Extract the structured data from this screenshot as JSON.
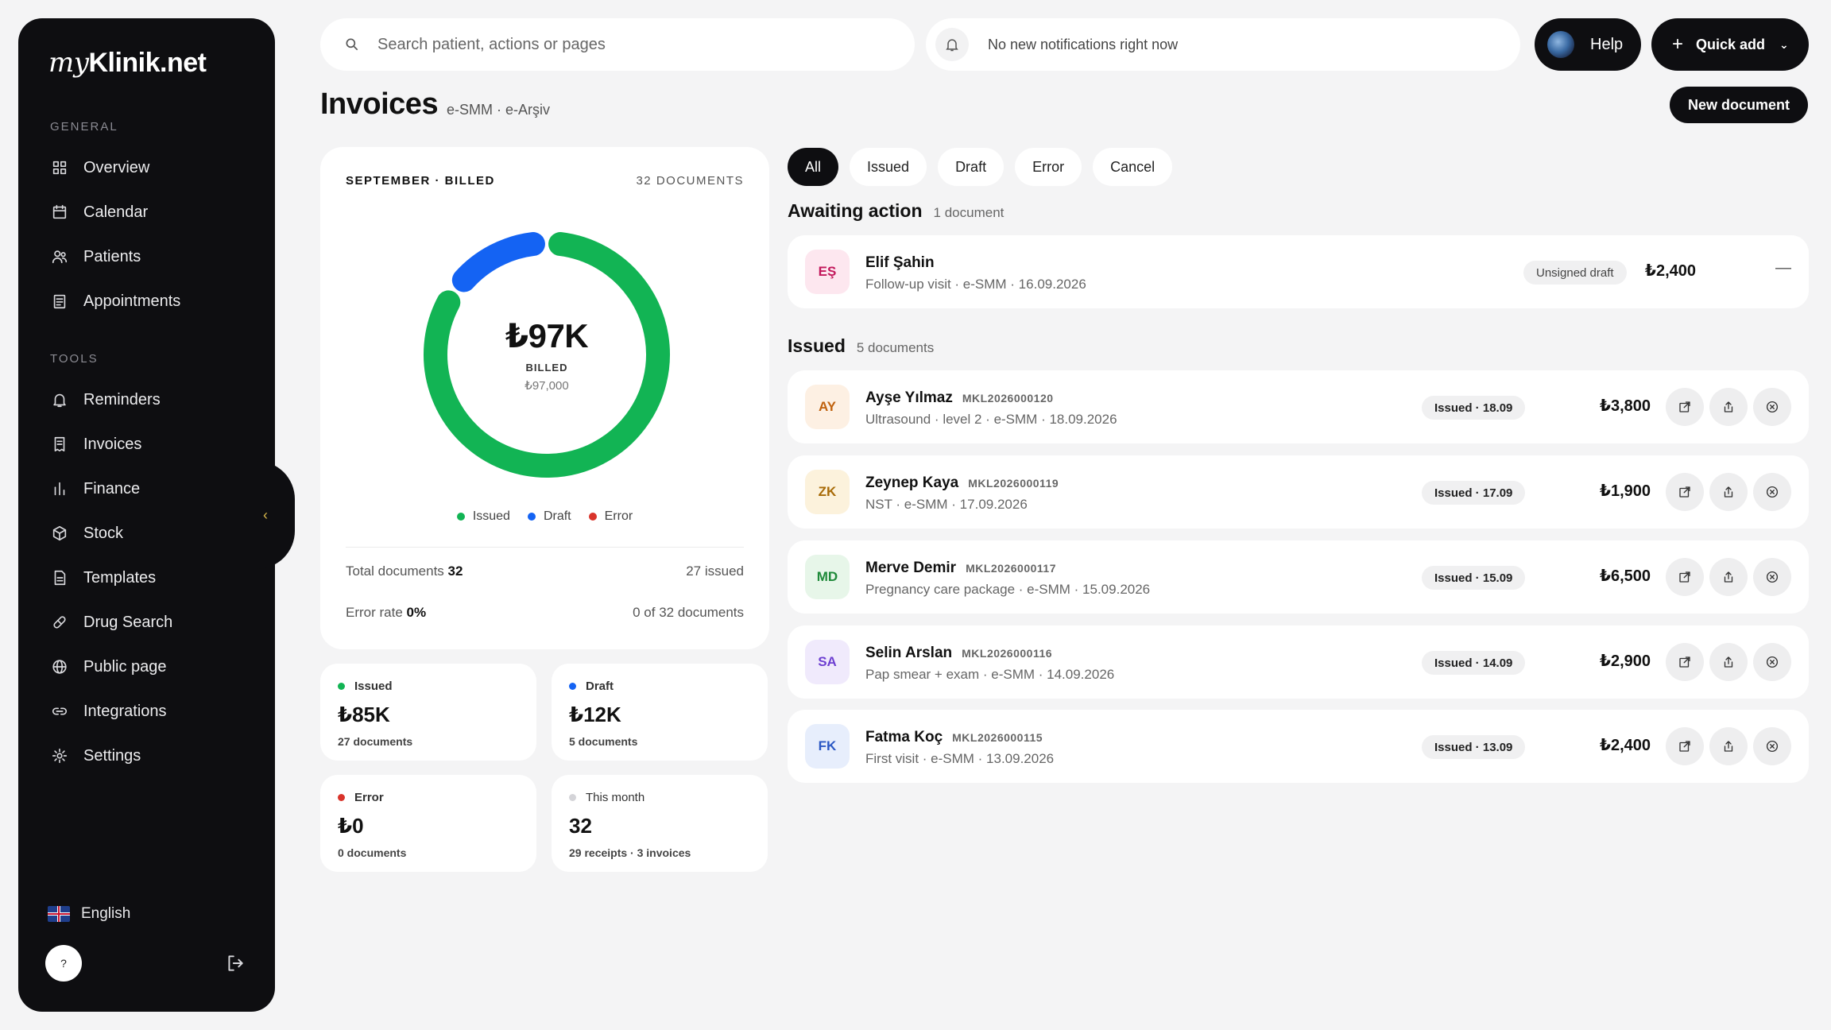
{
  "sidebar": {
    "logo_prefix": "my",
    "logo_rest": "Klinik.net",
    "general_label": "GENERAL",
    "tools_label": "TOOLS",
    "general_items": [
      {
        "label": "Overview",
        "icon": "grid-icon"
      },
      {
        "label": "Calendar",
        "icon": "calendar-icon"
      },
      {
        "label": "Patients",
        "icon": "users-icon"
      },
      {
        "label": "Appointments",
        "icon": "clipboard-icon"
      }
    ],
    "tools_items": [
      {
        "label": "Reminders",
        "icon": "bell-icon"
      },
      {
        "label": "Invoices",
        "icon": "receipt-icon"
      },
      {
        "label": "Finance",
        "icon": "bar-chart-icon"
      },
      {
        "label": "Stock",
        "icon": "box-icon"
      },
      {
        "label": "Templates",
        "icon": "document-icon"
      },
      {
        "label": "Drug Search",
        "icon": "pill-icon"
      },
      {
        "label": "Public page",
        "icon": "globe-icon"
      },
      {
        "label": "Integrations",
        "icon": "link-icon"
      },
      {
        "label": "Settings",
        "icon": "gear-icon"
      }
    ],
    "language": "English",
    "help_glyph": "?",
    "collapse_glyph": "‹"
  },
  "topbar": {
    "search_placeholder": "Search patient, actions or pages",
    "notification_text": "No new notifications right now",
    "help_label": "Help",
    "quick_add_label": "Quick add"
  },
  "page": {
    "title": "Invoices",
    "subtitle": "e-SMM · e-Arşiv",
    "new_document_label": "New document"
  },
  "summary": {
    "heading": "SEPTEMBER · BILLED",
    "doc_count_label": "32 DOCUMENTS",
    "center_value": "₺97K",
    "center_label": "BILLED",
    "center_exact": "₺97,000",
    "legend": [
      {
        "label": "Issued",
        "color": "#12b454"
      },
      {
        "label": "Draft",
        "color": "#1463f3"
      },
      {
        "label": "Error",
        "color": "#d9342b"
      }
    ],
    "total_docs_label": "Total documents",
    "total_docs_value": "32",
    "issued_count": "27 issued",
    "error_rate_label": "Error rate",
    "error_rate_value": "0%",
    "error_detail": "0 of 32 documents"
  },
  "donut": {
    "issued_value": 85,
    "draft_value": 12,
    "error_value": 0,
    "issued_color": "#12b454",
    "draft_color": "#1463f3"
  },
  "stats": [
    {
      "label": "Issued",
      "value": "₺85K",
      "sub": "27 documents",
      "color": "#12b454"
    },
    {
      "label": "Draft",
      "value": "₺12K",
      "sub": "5 documents",
      "color": "#1463f3"
    },
    {
      "label": "Error",
      "value": "₺0",
      "sub": "0 documents",
      "color": "#d9342b"
    },
    {
      "label": "This month",
      "value": "32",
      "sub": "29 receipts · 3 invoices",
      "color": "#d4d4d8"
    }
  ],
  "filters": [
    "All",
    "Issued",
    "Draft",
    "Error",
    "Cancel"
  ],
  "awaiting": {
    "title": "Awaiting action",
    "count": "1 document",
    "rows": [
      {
        "initials": "EŞ",
        "name": "Elif Şahin",
        "code": "",
        "detail": "Follow-up visit · e-SMM · 16.09.2026",
        "badge": "Unsigned draft",
        "amount": "₺2,400",
        "dash": "—",
        "avatar_bg": "#fde7ef",
        "avatar_fg": "#c2185b"
      }
    ]
  },
  "issued": {
    "title": "Issued",
    "count": "5 documents",
    "rows": [
      {
        "initials": "AY",
        "name": "Ayşe Yılmaz",
        "code": "MKL2026000120",
        "detail": "Ultrasound · level 2 · e-SMM · 18.09.2026",
        "badge": "Issued · 18.09",
        "amount": "₺3,800",
        "avatar_bg": "#fdf0e3",
        "avatar_fg": "#c0620e"
      },
      {
        "initials": "ZK",
        "name": "Zeynep Kaya",
        "code": "MKL2026000119",
        "detail": "NST · e-SMM · 17.09.2026",
        "badge": "Issued · 17.09",
        "amount": "₺1,900",
        "avatar_bg": "#fcf2dc",
        "avatar_fg": "#a86b07"
      },
      {
        "initials": "MD",
        "name": "Merve Demir",
        "code": "MKL2026000117",
        "detail": "Pregnancy care package · e-SMM · 15.09.2026",
        "badge": "Issued · 15.09",
        "amount": "₺6,500",
        "avatar_bg": "#e7f6e9",
        "avatar_fg": "#1f8a3a"
      },
      {
        "initials": "SA",
        "name": "Selin Arslan",
        "code": "MKL2026000116",
        "detail": "Pap smear + exam · e-SMM · 14.09.2026",
        "badge": "Issued · 14.09",
        "amount": "₺2,900",
        "avatar_bg": "#f0eafc",
        "avatar_fg": "#6d3fd1"
      },
      {
        "initials": "FK",
        "name": "Fatma Koç",
        "code": "MKL2026000115",
        "detail": "First visit · e-SMM · 13.09.2026",
        "badge": "Issued · 13.09",
        "amount": "₺2,400",
        "avatar_bg": "#e7eefc",
        "avatar_fg": "#2b58c4"
      }
    ]
  }
}
